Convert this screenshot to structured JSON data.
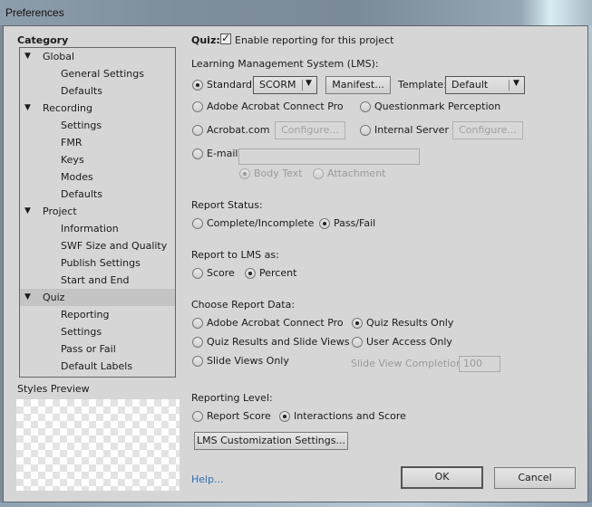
{
  "window": {
    "title": "Preferences"
  },
  "sidebar": {
    "category_label": "Category",
    "tree": [
      {
        "label": "Global",
        "type": "parent",
        "expanded": true
      },
      {
        "label": "General Settings",
        "type": "child"
      },
      {
        "label": "Defaults",
        "type": "child"
      },
      {
        "label": "Recording",
        "type": "parent",
        "expanded": true
      },
      {
        "label": "Settings",
        "type": "child"
      },
      {
        "label": "FMR",
        "type": "child"
      },
      {
        "label": "Keys",
        "type": "child"
      },
      {
        "label": "Modes",
        "type": "child"
      },
      {
        "label": "Defaults",
        "type": "child"
      },
      {
        "label": "Project",
        "type": "parent",
        "expanded": true
      },
      {
        "label": "Information",
        "type": "child"
      },
      {
        "label": "SWF Size and Quality",
        "type": "child"
      },
      {
        "label": "Publish Settings",
        "type": "child"
      },
      {
        "label": "Start and End",
        "type": "child"
      },
      {
        "label": "Quiz",
        "type": "parent",
        "expanded": true,
        "selected": true
      },
      {
        "label": "Reporting",
        "type": "child"
      },
      {
        "label": "Settings",
        "type": "child"
      },
      {
        "label": "Pass or Fail",
        "type": "child"
      },
      {
        "label": "Default Labels",
        "type": "child"
      }
    ],
    "styles_preview_label": "Styles Preview"
  },
  "main": {
    "section_label": "Quiz:",
    "enable_reporting": {
      "label": "Enable reporting for this project",
      "checked": true
    },
    "lms": {
      "heading": "Learning Management System (LMS):",
      "standard_label": "Standard:",
      "standard_value": "SCORM",
      "manifest_button": "Manifest...",
      "template_label": "Template:",
      "template_value": "Default",
      "adobe_connect": "Adobe Acrobat Connect Pro",
      "questionmark": "Questionmark Perception",
      "acrobat_com": "Acrobat.com",
      "configure_button_1": "Configure...",
      "internal_server": "Internal Server",
      "configure_button_2": "Configure...",
      "email_label": "E-mail:",
      "email_value": "",
      "body_text": "Body Text",
      "attachment": "Attachment",
      "selected": "Standard"
    },
    "report_status": {
      "heading": "Report Status:",
      "options": [
        "Complete/Incomplete",
        "Pass/Fail"
      ],
      "selected": "Pass/Fail"
    },
    "report_as": {
      "heading": "Report to LMS as:",
      "options": [
        "Score",
        "Percent"
      ],
      "selected": "Percent"
    },
    "report_data": {
      "heading": "Choose Report Data:",
      "options": [
        "Adobe Acrobat Connect Pro",
        "Quiz Results Only",
        "Quiz Results and Slide Views",
        "User Access Only",
        "Slide Views Only"
      ],
      "selected": "Quiz Results Only",
      "slide_view_completion_label": "Slide View Completion",
      "slide_view_completion_value": "100"
    },
    "reporting_level": {
      "heading": "Reporting Level:",
      "options": [
        "Report Score",
        "Interactions and Score"
      ],
      "selected": "Interactions and Score"
    },
    "lms_customization_button": "LMS Customization Settings..."
  },
  "footer": {
    "help_link": "Help...",
    "ok_button": "OK",
    "cancel_button": "Cancel"
  }
}
